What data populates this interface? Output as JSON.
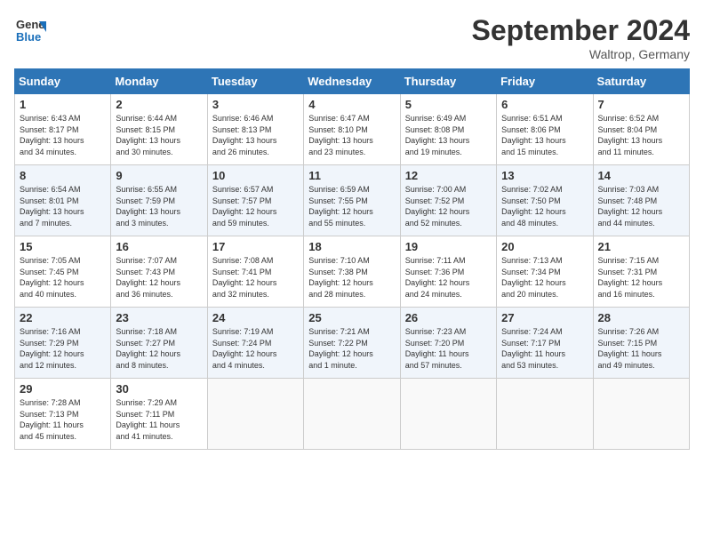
{
  "logo": {
    "line1": "General",
    "line2": "Blue"
  },
  "title": "September 2024",
  "subtitle": "Waltrop, Germany",
  "days_header": [
    "Sunday",
    "Monday",
    "Tuesday",
    "Wednesday",
    "Thursday",
    "Friday",
    "Saturday"
  ],
  "weeks": [
    [
      {
        "day": "1",
        "info": "Sunrise: 6:43 AM\nSunset: 8:17 PM\nDaylight: 13 hours\nand 34 minutes."
      },
      {
        "day": "2",
        "info": "Sunrise: 6:44 AM\nSunset: 8:15 PM\nDaylight: 13 hours\nand 30 minutes."
      },
      {
        "day": "3",
        "info": "Sunrise: 6:46 AM\nSunset: 8:13 PM\nDaylight: 13 hours\nand 26 minutes."
      },
      {
        "day": "4",
        "info": "Sunrise: 6:47 AM\nSunset: 8:10 PM\nDaylight: 13 hours\nand 23 minutes."
      },
      {
        "day": "5",
        "info": "Sunrise: 6:49 AM\nSunset: 8:08 PM\nDaylight: 13 hours\nand 19 minutes."
      },
      {
        "day": "6",
        "info": "Sunrise: 6:51 AM\nSunset: 8:06 PM\nDaylight: 13 hours\nand 15 minutes."
      },
      {
        "day": "7",
        "info": "Sunrise: 6:52 AM\nSunset: 8:04 PM\nDaylight: 13 hours\nand 11 minutes."
      }
    ],
    [
      {
        "day": "8",
        "info": "Sunrise: 6:54 AM\nSunset: 8:01 PM\nDaylight: 13 hours\nand 7 minutes."
      },
      {
        "day": "9",
        "info": "Sunrise: 6:55 AM\nSunset: 7:59 PM\nDaylight: 13 hours\nand 3 minutes."
      },
      {
        "day": "10",
        "info": "Sunrise: 6:57 AM\nSunset: 7:57 PM\nDaylight: 12 hours\nand 59 minutes."
      },
      {
        "day": "11",
        "info": "Sunrise: 6:59 AM\nSunset: 7:55 PM\nDaylight: 12 hours\nand 55 minutes."
      },
      {
        "day": "12",
        "info": "Sunrise: 7:00 AM\nSunset: 7:52 PM\nDaylight: 12 hours\nand 52 minutes."
      },
      {
        "day": "13",
        "info": "Sunrise: 7:02 AM\nSunset: 7:50 PM\nDaylight: 12 hours\nand 48 minutes."
      },
      {
        "day": "14",
        "info": "Sunrise: 7:03 AM\nSunset: 7:48 PM\nDaylight: 12 hours\nand 44 minutes."
      }
    ],
    [
      {
        "day": "15",
        "info": "Sunrise: 7:05 AM\nSunset: 7:45 PM\nDaylight: 12 hours\nand 40 minutes."
      },
      {
        "day": "16",
        "info": "Sunrise: 7:07 AM\nSunset: 7:43 PM\nDaylight: 12 hours\nand 36 minutes."
      },
      {
        "day": "17",
        "info": "Sunrise: 7:08 AM\nSunset: 7:41 PM\nDaylight: 12 hours\nand 32 minutes."
      },
      {
        "day": "18",
        "info": "Sunrise: 7:10 AM\nSunset: 7:38 PM\nDaylight: 12 hours\nand 28 minutes."
      },
      {
        "day": "19",
        "info": "Sunrise: 7:11 AM\nSunset: 7:36 PM\nDaylight: 12 hours\nand 24 minutes."
      },
      {
        "day": "20",
        "info": "Sunrise: 7:13 AM\nSunset: 7:34 PM\nDaylight: 12 hours\nand 20 minutes."
      },
      {
        "day": "21",
        "info": "Sunrise: 7:15 AM\nSunset: 7:31 PM\nDaylight: 12 hours\nand 16 minutes."
      }
    ],
    [
      {
        "day": "22",
        "info": "Sunrise: 7:16 AM\nSunset: 7:29 PM\nDaylight: 12 hours\nand 12 minutes."
      },
      {
        "day": "23",
        "info": "Sunrise: 7:18 AM\nSunset: 7:27 PM\nDaylight: 12 hours\nand 8 minutes."
      },
      {
        "day": "24",
        "info": "Sunrise: 7:19 AM\nSunset: 7:24 PM\nDaylight: 12 hours\nand 4 minutes."
      },
      {
        "day": "25",
        "info": "Sunrise: 7:21 AM\nSunset: 7:22 PM\nDaylight: 12 hours\nand 1 minute."
      },
      {
        "day": "26",
        "info": "Sunrise: 7:23 AM\nSunset: 7:20 PM\nDaylight: 11 hours\nand 57 minutes."
      },
      {
        "day": "27",
        "info": "Sunrise: 7:24 AM\nSunset: 7:17 PM\nDaylight: 11 hours\nand 53 minutes."
      },
      {
        "day": "28",
        "info": "Sunrise: 7:26 AM\nSunset: 7:15 PM\nDaylight: 11 hours\nand 49 minutes."
      }
    ],
    [
      {
        "day": "29",
        "info": "Sunrise: 7:28 AM\nSunset: 7:13 PM\nDaylight: 11 hours\nand 45 minutes."
      },
      {
        "day": "30",
        "info": "Sunrise: 7:29 AM\nSunset: 7:11 PM\nDaylight: 11 hours\nand 41 minutes."
      },
      {
        "day": "",
        "info": ""
      },
      {
        "day": "",
        "info": ""
      },
      {
        "day": "",
        "info": ""
      },
      {
        "day": "",
        "info": ""
      },
      {
        "day": "",
        "info": ""
      }
    ]
  ]
}
